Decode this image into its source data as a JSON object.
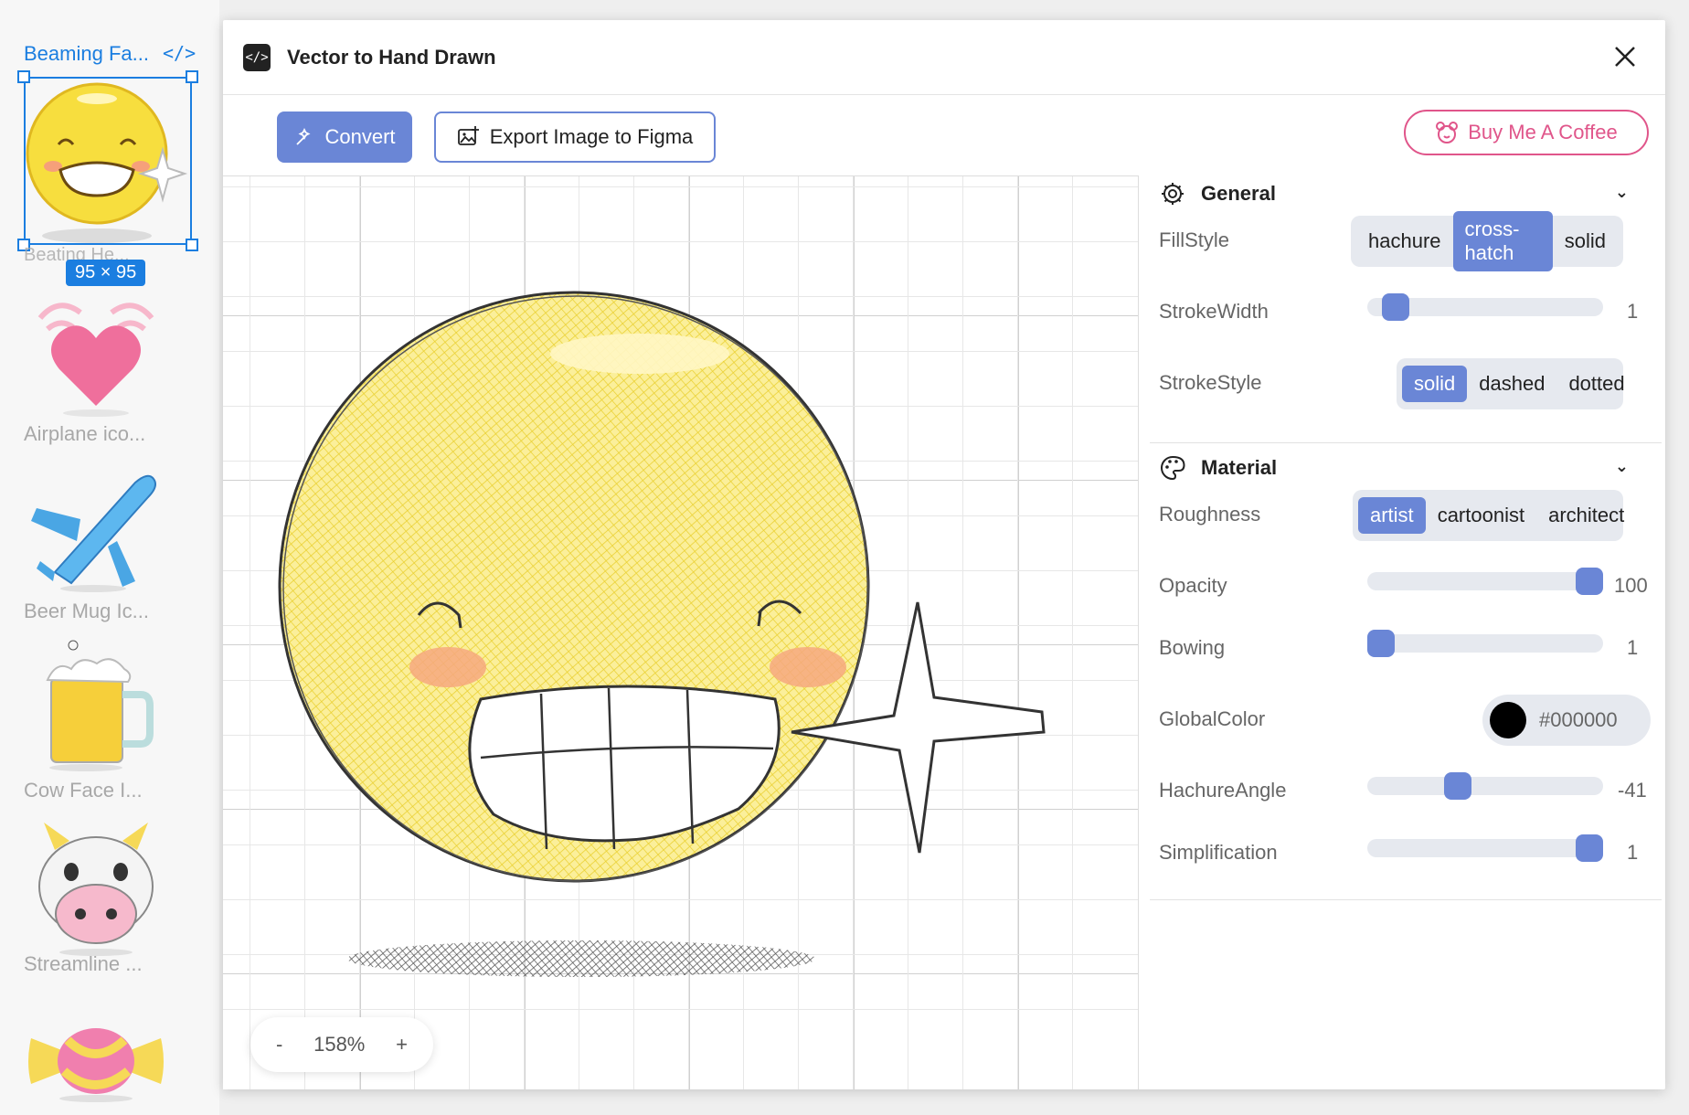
{
  "layers": {
    "active_label": "Beaming Fa...",
    "overlapped_label": "Beating He...",
    "size_badge": "95 × 95",
    "items": [
      {
        "label": "Airplane ico..."
      },
      {
        "label": "Beer Mug Ic..."
      },
      {
        "label": "Cow Face I..."
      },
      {
        "label": "Streamline ..."
      }
    ]
  },
  "window": {
    "title": "Vector to Hand Drawn",
    "convert_label": "Convert",
    "export_label": "Export Image to Figma",
    "coffee_label": "Buy Me A Coffee"
  },
  "canvas": {
    "zoom_minus": "-",
    "zoom_value": "158%",
    "zoom_plus": "+"
  },
  "general": {
    "heading": "General",
    "fillstyle": {
      "label": "FillStyle",
      "options": [
        "hachure",
        "cross-hatch",
        "solid"
      ],
      "selected": "cross-hatch"
    },
    "strokewidth": {
      "label": "StrokeWidth",
      "value": "1",
      "fraction": 0.07
    },
    "strokestyle": {
      "label": "StrokeStyle",
      "options": [
        "solid",
        "dashed",
        "dotted"
      ],
      "selected": "solid"
    }
  },
  "material": {
    "heading": "Material",
    "roughness": {
      "label": "Roughness",
      "options": [
        "artist",
        "cartoonist",
        "architect"
      ],
      "selected": "artist"
    },
    "opacity": {
      "label": "Opacity",
      "value": "100",
      "fraction": 1.0
    },
    "bowing": {
      "label": "Bowing",
      "value": "1",
      "fraction": 0.0
    },
    "globalcolor": {
      "label": "GlobalColor",
      "value": "#000000",
      "swatch": "#000000"
    },
    "hachureangle": {
      "label": "HachureAngle",
      "value": "-41",
      "fraction": 0.37
    },
    "simplification": {
      "label": "Simplification",
      "value": "1",
      "fraction": 1.0
    }
  },
  "colors": {
    "accent": "#6a86d6",
    "figma_blue": "#1b7ee0",
    "coffee_pink": "#e0558a",
    "emoji_yellow": "#f7e04a"
  }
}
